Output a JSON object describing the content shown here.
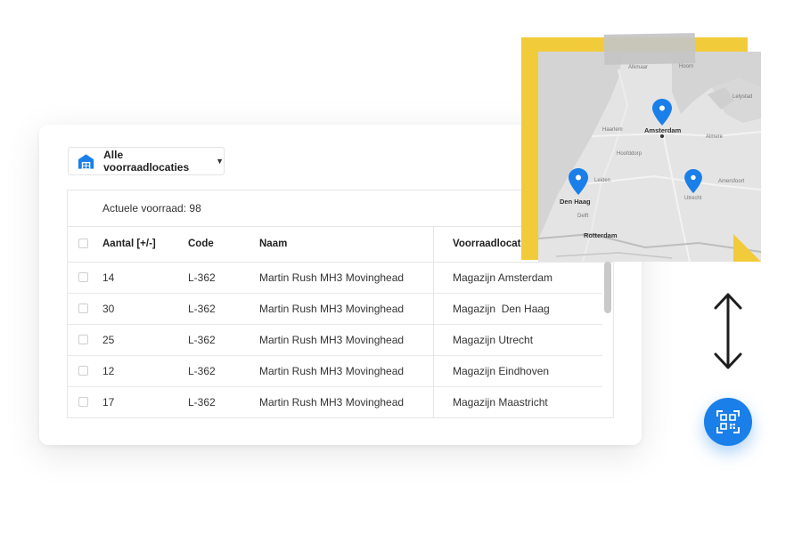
{
  "location_select": {
    "label": "Alle voorraadlocaties",
    "icon": "warehouse-icon"
  },
  "stock": {
    "label": "Actuele voorraad: 98"
  },
  "table": {
    "headers": {
      "qty": "Aantal [+/-]",
      "code": "Code",
      "name": "Naam",
      "location": "Voorraadlocatie"
    },
    "rows": [
      {
        "qty": "14",
        "code": "L-362",
        "name": "Martin Rush MH3 Movinghead",
        "location": "Magazijn Amsterdam"
      },
      {
        "qty": "30",
        "code": "L-362",
        "name": "Martin Rush MH3 Movinghead",
        "location": "Magazijn  Den Haag"
      },
      {
        "qty": "25",
        "code": "L-362",
        "name": "Martin Rush MH3 Movinghead",
        "location": "Magazijn Utrecht"
      },
      {
        "qty": "12",
        "code": "L-362",
        "name": "Martin Rush MH3 Movinghead",
        "location": "Magazijn Eindhoven"
      },
      {
        "qty": "17",
        "code": "L-362",
        "name": "Martin Rush MH3 Movinghead",
        "location": "Magazijn Maastricht"
      }
    ]
  },
  "map": {
    "cities": {
      "amsterdam": "Amsterdam",
      "den_haag": "Den Haag",
      "rotterdam": "Rotterdam"
    },
    "labels": {
      "alkmaar": "Alkmaar",
      "hoorn": "Hoorn",
      "lelystad": "Lelystad",
      "haarlem": "Haarlem",
      "almere": "Almere",
      "hoofddorp": "Hoofddorp",
      "leiden": "Leiden",
      "utrecht": "Utrecht",
      "amersfoort": "Amersfoort",
      "delft": "Delft"
    }
  },
  "colors": {
    "accent": "#1a7fe8",
    "note_yellow": "#f2cb3a",
    "map_pin": "#1a7fe8"
  },
  "qr_button": {
    "icon": "qr-scan-icon"
  },
  "arrow": {
    "icon": "double-arrow-icon"
  }
}
